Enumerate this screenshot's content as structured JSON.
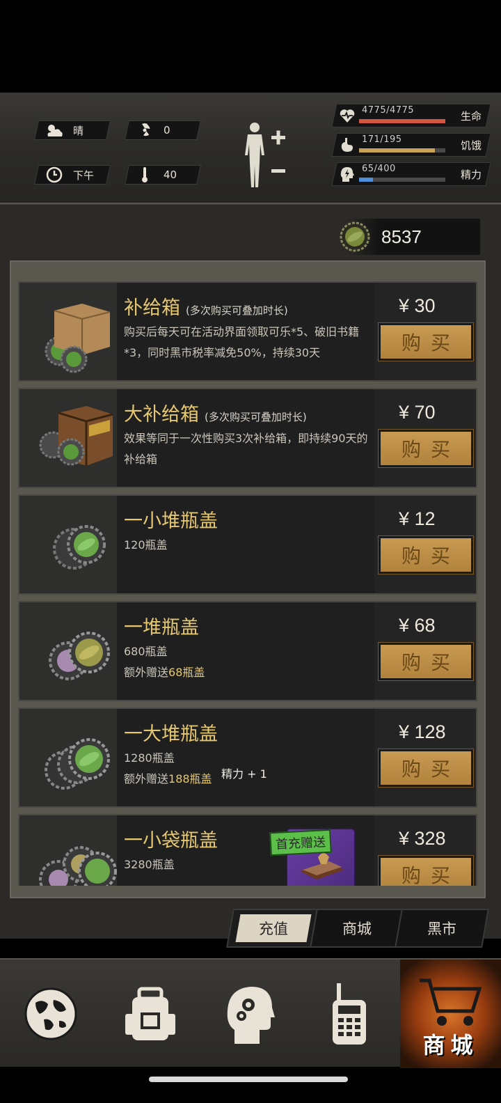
{
  "environment": {
    "weather": "晴",
    "radiation": "0",
    "time_of_day": "下午",
    "temperature": "40"
  },
  "stats": [
    {
      "label": "生命",
      "value": "4775/4775",
      "fraction": 1.0,
      "color": "#d2553f",
      "icon": "heart-icon"
    },
    {
      "label": "饥饿",
      "value": "171/195",
      "fraction": 0.88,
      "color": "#c9a25a",
      "icon": "stomach-icon"
    },
    {
      "label": "精力",
      "value": "65/400",
      "fraction": 0.16,
      "color": "#4d8fd8",
      "icon": "energy-head-icon"
    }
  ],
  "currency": {
    "amount": "8537",
    "icon": "bottle-cap-icon"
  },
  "items": [
    {
      "name": "补给箱",
      "note": "(多次购买可叠加时长)",
      "desc": "购买后每天可在活动界面领取可乐*5、破旧书籍*3，同时黑市税率减免50%，持续30天",
      "price": "¥ 30",
      "buy": "购买",
      "icon": "supply-box-icon"
    },
    {
      "name": "大补给箱",
      "note": "(多次购买可叠加时长)",
      "desc": "效果等同于一次性购买3次补给箱，即持续90天的补给箱",
      "price": "¥ 70",
      "buy": "购买",
      "icon": "large-supply-crate-icon"
    },
    {
      "name": "一小堆瓶盖",
      "desc1": "120瓶盖",
      "price": "¥ 12",
      "buy": "购买",
      "icon": "small-cap-pile-icon"
    },
    {
      "name": "一堆瓶盖",
      "desc1": "680瓶盖",
      "desc2_prefix": "额外赠送",
      "desc2_hl": "68瓶盖",
      "price": "¥ 68",
      "buy": "购买",
      "icon": "cap-pile-icon"
    },
    {
      "name": "一大堆瓶盖",
      "desc1": "1280瓶盖",
      "desc2_prefix": "额外赠送",
      "desc2_hl": "188瓶盖",
      "bonus": "精力 + 1",
      "price": "¥ 128",
      "buy": "购买",
      "icon": "big-cap-pile-icon"
    },
    {
      "name": "一小袋瓶盖",
      "desc1": "3280瓶盖",
      "gift_banner": "首充赠送",
      "price": "¥ 328",
      "buy": "购买",
      "icon": "cap-bag-icon"
    }
  ],
  "tabs": [
    {
      "label": "充值",
      "active": true
    },
    {
      "label": "商城",
      "active": false
    },
    {
      "label": "黑市",
      "active": false
    }
  ],
  "nav": {
    "items": [
      "globe-icon",
      "backpack-icon",
      "skills-head-icon",
      "radio-icon",
      "cart-icon"
    ],
    "active_label": "商城"
  }
}
